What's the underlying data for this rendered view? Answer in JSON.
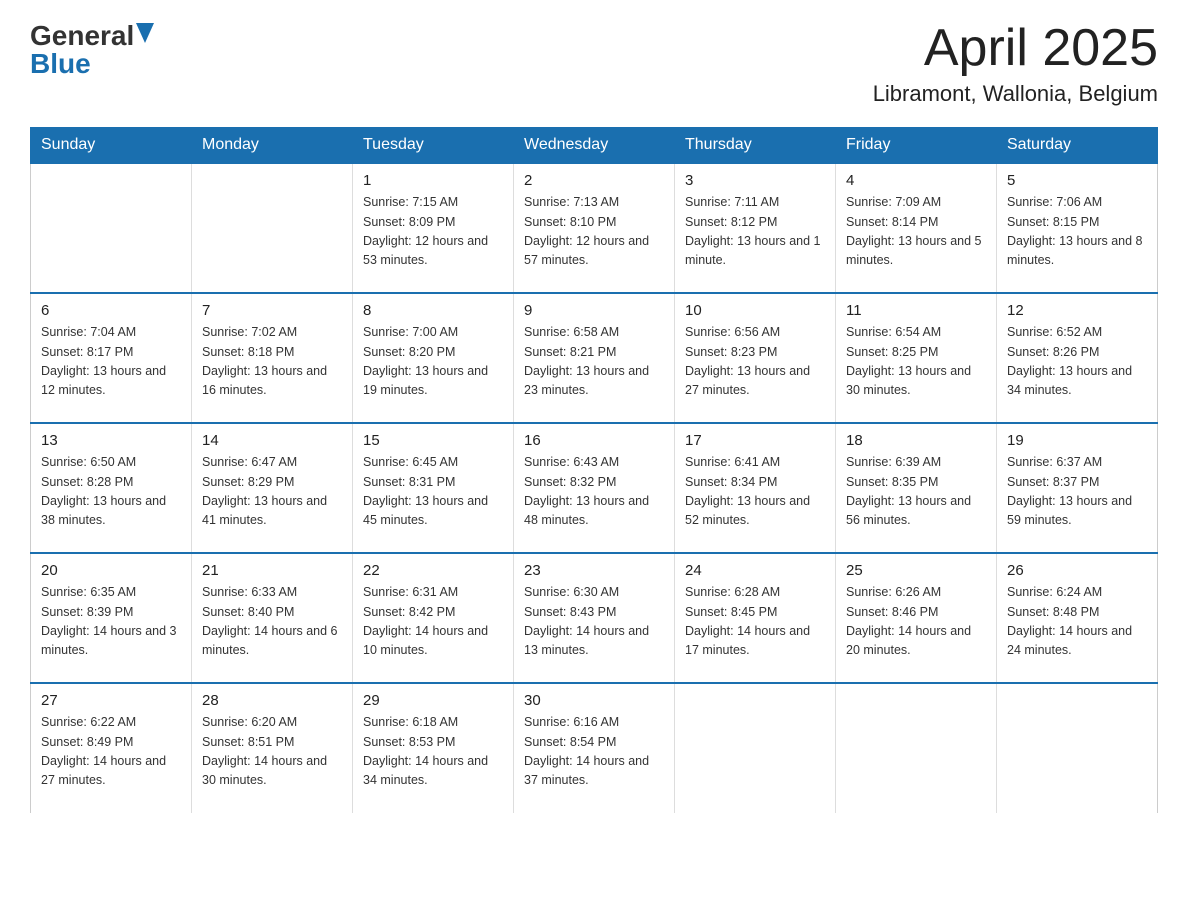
{
  "logo": {
    "general": "General",
    "blue": "Blue"
  },
  "title": "April 2025",
  "location": "Libramont, Wallonia, Belgium",
  "weekdays": [
    "Sunday",
    "Monday",
    "Tuesday",
    "Wednesday",
    "Thursday",
    "Friday",
    "Saturday"
  ],
  "weeks": [
    [
      {
        "day": "",
        "sunrise": "",
        "sunset": "",
        "daylight": ""
      },
      {
        "day": "",
        "sunrise": "",
        "sunset": "",
        "daylight": ""
      },
      {
        "day": "1",
        "sunrise": "Sunrise: 7:15 AM",
        "sunset": "Sunset: 8:09 PM",
        "daylight": "Daylight: 12 hours and 53 minutes."
      },
      {
        "day": "2",
        "sunrise": "Sunrise: 7:13 AM",
        "sunset": "Sunset: 8:10 PM",
        "daylight": "Daylight: 12 hours and 57 minutes."
      },
      {
        "day": "3",
        "sunrise": "Sunrise: 7:11 AM",
        "sunset": "Sunset: 8:12 PM",
        "daylight": "Daylight: 13 hours and 1 minute."
      },
      {
        "day": "4",
        "sunrise": "Sunrise: 7:09 AM",
        "sunset": "Sunset: 8:14 PM",
        "daylight": "Daylight: 13 hours and 5 minutes."
      },
      {
        "day": "5",
        "sunrise": "Sunrise: 7:06 AM",
        "sunset": "Sunset: 8:15 PM",
        "daylight": "Daylight: 13 hours and 8 minutes."
      }
    ],
    [
      {
        "day": "6",
        "sunrise": "Sunrise: 7:04 AM",
        "sunset": "Sunset: 8:17 PM",
        "daylight": "Daylight: 13 hours and 12 minutes."
      },
      {
        "day": "7",
        "sunrise": "Sunrise: 7:02 AM",
        "sunset": "Sunset: 8:18 PM",
        "daylight": "Daylight: 13 hours and 16 minutes."
      },
      {
        "day": "8",
        "sunrise": "Sunrise: 7:00 AM",
        "sunset": "Sunset: 8:20 PM",
        "daylight": "Daylight: 13 hours and 19 minutes."
      },
      {
        "day": "9",
        "sunrise": "Sunrise: 6:58 AM",
        "sunset": "Sunset: 8:21 PM",
        "daylight": "Daylight: 13 hours and 23 minutes."
      },
      {
        "day": "10",
        "sunrise": "Sunrise: 6:56 AM",
        "sunset": "Sunset: 8:23 PM",
        "daylight": "Daylight: 13 hours and 27 minutes."
      },
      {
        "day": "11",
        "sunrise": "Sunrise: 6:54 AM",
        "sunset": "Sunset: 8:25 PM",
        "daylight": "Daylight: 13 hours and 30 minutes."
      },
      {
        "day": "12",
        "sunrise": "Sunrise: 6:52 AM",
        "sunset": "Sunset: 8:26 PM",
        "daylight": "Daylight: 13 hours and 34 minutes."
      }
    ],
    [
      {
        "day": "13",
        "sunrise": "Sunrise: 6:50 AM",
        "sunset": "Sunset: 8:28 PM",
        "daylight": "Daylight: 13 hours and 38 minutes."
      },
      {
        "day": "14",
        "sunrise": "Sunrise: 6:47 AM",
        "sunset": "Sunset: 8:29 PM",
        "daylight": "Daylight: 13 hours and 41 minutes."
      },
      {
        "day": "15",
        "sunrise": "Sunrise: 6:45 AM",
        "sunset": "Sunset: 8:31 PM",
        "daylight": "Daylight: 13 hours and 45 minutes."
      },
      {
        "day": "16",
        "sunrise": "Sunrise: 6:43 AM",
        "sunset": "Sunset: 8:32 PM",
        "daylight": "Daylight: 13 hours and 48 minutes."
      },
      {
        "day": "17",
        "sunrise": "Sunrise: 6:41 AM",
        "sunset": "Sunset: 8:34 PM",
        "daylight": "Daylight: 13 hours and 52 minutes."
      },
      {
        "day": "18",
        "sunrise": "Sunrise: 6:39 AM",
        "sunset": "Sunset: 8:35 PM",
        "daylight": "Daylight: 13 hours and 56 minutes."
      },
      {
        "day": "19",
        "sunrise": "Sunrise: 6:37 AM",
        "sunset": "Sunset: 8:37 PM",
        "daylight": "Daylight: 13 hours and 59 minutes."
      }
    ],
    [
      {
        "day": "20",
        "sunrise": "Sunrise: 6:35 AM",
        "sunset": "Sunset: 8:39 PM",
        "daylight": "Daylight: 14 hours and 3 minutes."
      },
      {
        "day": "21",
        "sunrise": "Sunrise: 6:33 AM",
        "sunset": "Sunset: 8:40 PM",
        "daylight": "Daylight: 14 hours and 6 minutes."
      },
      {
        "day": "22",
        "sunrise": "Sunrise: 6:31 AM",
        "sunset": "Sunset: 8:42 PM",
        "daylight": "Daylight: 14 hours and 10 minutes."
      },
      {
        "day": "23",
        "sunrise": "Sunrise: 6:30 AM",
        "sunset": "Sunset: 8:43 PM",
        "daylight": "Daylight: 14 hours and 13 minutes."
      },
      {
        "day": "24",
        "sunrise": "Sunrise: 6:28 AM",
        "sunset": "Sunset: 8:45 PM",
        "daylight": "Daylight: 14 hours and 17 minutes."
      },
      {
        "day": "25",
        "sunrise": "Sunrise: 6:26 AM",
        "sunset": "Sunset: 8:46 PM",
        "daylight": "Daylight: 14 hours and 20 minutes."
      },
      {
        "day": "26",
        "sunrise": "Sunrise: 6:24 AM",
        "sunset": "Sunset: 8:48 PM",
        "daylight": "Daylight: 14 hours and 24 minutes."
      }
    ],
    [
      {
        "day": "27",
        "sunrise": "Sunrise: 6:22 AM",
        "sunset": "Sunset: 8:49 PM",
        "daylight": "Daylight: 14 hours and 27 minutes."
      },
      {
        "day": "28",
        "sunrise": "Sunrise: 6:20 AM",
        "sunset": "Sunset: 8:51 PM",
        "daylight": "Daylight: 14 hours and 30 minutes."
      },
      {
        "day": "29",
        "sunrise": "Sunrise: 6:18 AM",
        "sunset": "Sunset: 8:53 PM",
        "daylight": "Daylight: 14 hours and 34 minutes."
      },
      {
        "day": "30",
        "sunrise": "Sunrise: 6:16 AM",
        "sunset": "Sunset: 8:54 PM",
        "daylight": "Daylight: 14 hours and 37 minutes."
      },
      {
        "day": "",
        "sunrise": "",
        "sunset": "",
        "daylight": ""
      },
      {
        "day": "",
        "sunrise": "",
        "sunset": "",
        "daylight": ""
      },
      {
        "day": "",
        "sunrise": "",
        "sunset": "",
        "daylight": ""
      }
    ]
  ]
}
